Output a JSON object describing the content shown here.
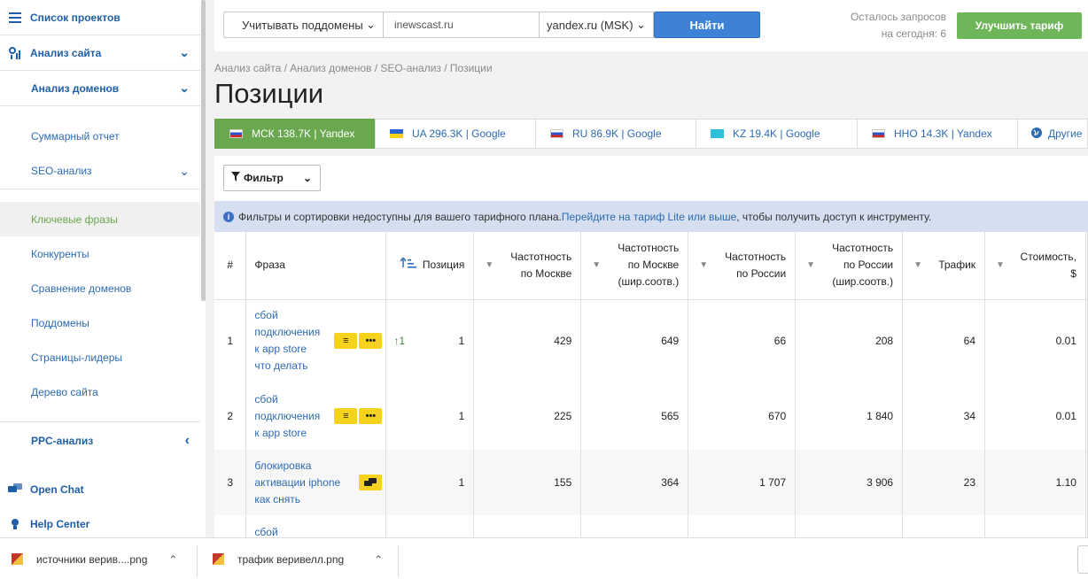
{
  "sidebar": {
    "items": [
      {
        "label": "Список проектов"
      },
      {
        "label": "Анализ сайта"
      },
      {
        "label": "Анализ доменов"
      },
      {
        "label": "Суммарный отчет"
      },
      {
        "label": "SEO-анализ"
      },
      {
        "label": "Ключевые фразы"
      },
      {
        "label": "Конкуренты"
      },
      {
        "label": "Сравнение доменов"
      },
      {
        "label": "Поддомены"
      },
      {
        "label": "Страницы-лидеры"
      },
      {
        "label": "Дерево сайта"
      },
      {
        "label": "PPC-анализ"
      },
      {
        "label": "Open Chat"
      },
      {
        "label": "Help Center"
      }
    ]
  },
  "topbar": {
    "subdomains_label": "Учитывать поддомены",
    "domain_value": "inewscast.ru",
    "engine_value": "yandex.ru (MSK)",
    "find_label": "Найти",
    "quota_line1": "Осталось запросов",
    "quota_line2": "на сегодня: 6",
    "upgrade_label": "Улучшить тариф"
  },
  "breadcrumb": "Анализ сайта / Анализ доменов / SEO-анализ / Позиции",
  "page_title": "Позиции",
  "tabs": [
    {
      "label": "МСК 138.7K | Yandex",
      "flag": "ru"
    },
    {
      "label": "UA 296.3K | Google",
      "flag": "ua"
    },
    {
      "label": "RU 86.9K | Google",
      "flag": "ru"
    },
    {
      "label": "KZ 19.4K | Google",
      "flag": "kz"
    },
    {
      "label": "ННО 14.3K | Yandex",
      "flag": "ru"
    },
    {
      "label": "Другие"
    }
  ],
  "filter_label": "Фильтр",
  "notice": {
    "text_before": "Фильтры и сортировки недоступны для вашего тарифного плана. ",
    "link": "Перейдите на тариф Lite или выше",
    "text_after": ", чтобы получить доступ к инструменту."
  },
  "table": {
    "headers": {
      "num": "#",
      "phrase": "Фраза",
      "position": "Позиция",
      "freq_msk_1": "Частотность",
      "freq_msk_2": "по Москве",
      "freqw_msk_1": "Частотность",
      "freqw_msk_2": "по Москве",
      "freqw_msk_3": "(шир.соотв.)",
      "freq_ru_1": "Частотность",
      "freq_ru_2": "по России",
      "freqw_ru_1": "Частотность",
      "freqw_ru_2": "по России",
      "freqw_ru_3": "(шир.соотв.)",
      "traffic": "Трафик",
      "cost_1": "Стоимость,",
      "cost_2": "$"
    },
    "rows": [
      {
        "num": "1",
        "phrase_lines": [
          "сбой",
          "подключения",
          "к app store",
          "что делать"
        ],
        "change": "1",
        "position": "1",
        "freq_msk": "429",
        "freqw_msk": "649",
        "freq_ru": "66",
        "freqw_ru": "208",
        "traffic": "64",
        "cost": "0.01"
      },
      {
        "num": "2",
        "phrase_lines": [
          "сбой",
          "подключения",
          "к app store"
        ],
        "change": "",
        "position": "1",
        "freq_msk": "225",
        "freqw_msk": "565",
        "freq_ru": "670",
        "freqw_ru": "1 840",
        "traffic": "34",
        "cost": "0.01"
      },
      {
        "num": "3",
        "phrase_lines": [
          "блокировка",
          "активации iphone",
          "как снять"
        ],
        "change": "",
        "position": "1",
        "freq_msk": "155",
        "freqw_msk": "364",
        "freq_ru": "1 707",
        "freqw_ru": "3 906",
        "traffic": "23",
        "cost": "1.10"
      },
      {
        "num": "",
        "phrase_lines": [
          "сбой"
        ],
        "change": "",
        "position": "",
        "freq_msk": "",
        "freqw_msk": "",
        "freq_ru": "",
        "freqw_ru": "",
        "traffic": "",
        "cost": ""
      }
    ]
  },
  "downloads": [
    {
      "name": "источники верив....png"
    },
    {
      "name": "трафик веривелл.png"
    }
  ],
  "colors": {
    "accent_green": "#6aa84f",
    "link_blue": "#2d6bb3",
    "button_blue": "#3d82d6",
    "tag_yellow": "#f5d21c"
  }
}
